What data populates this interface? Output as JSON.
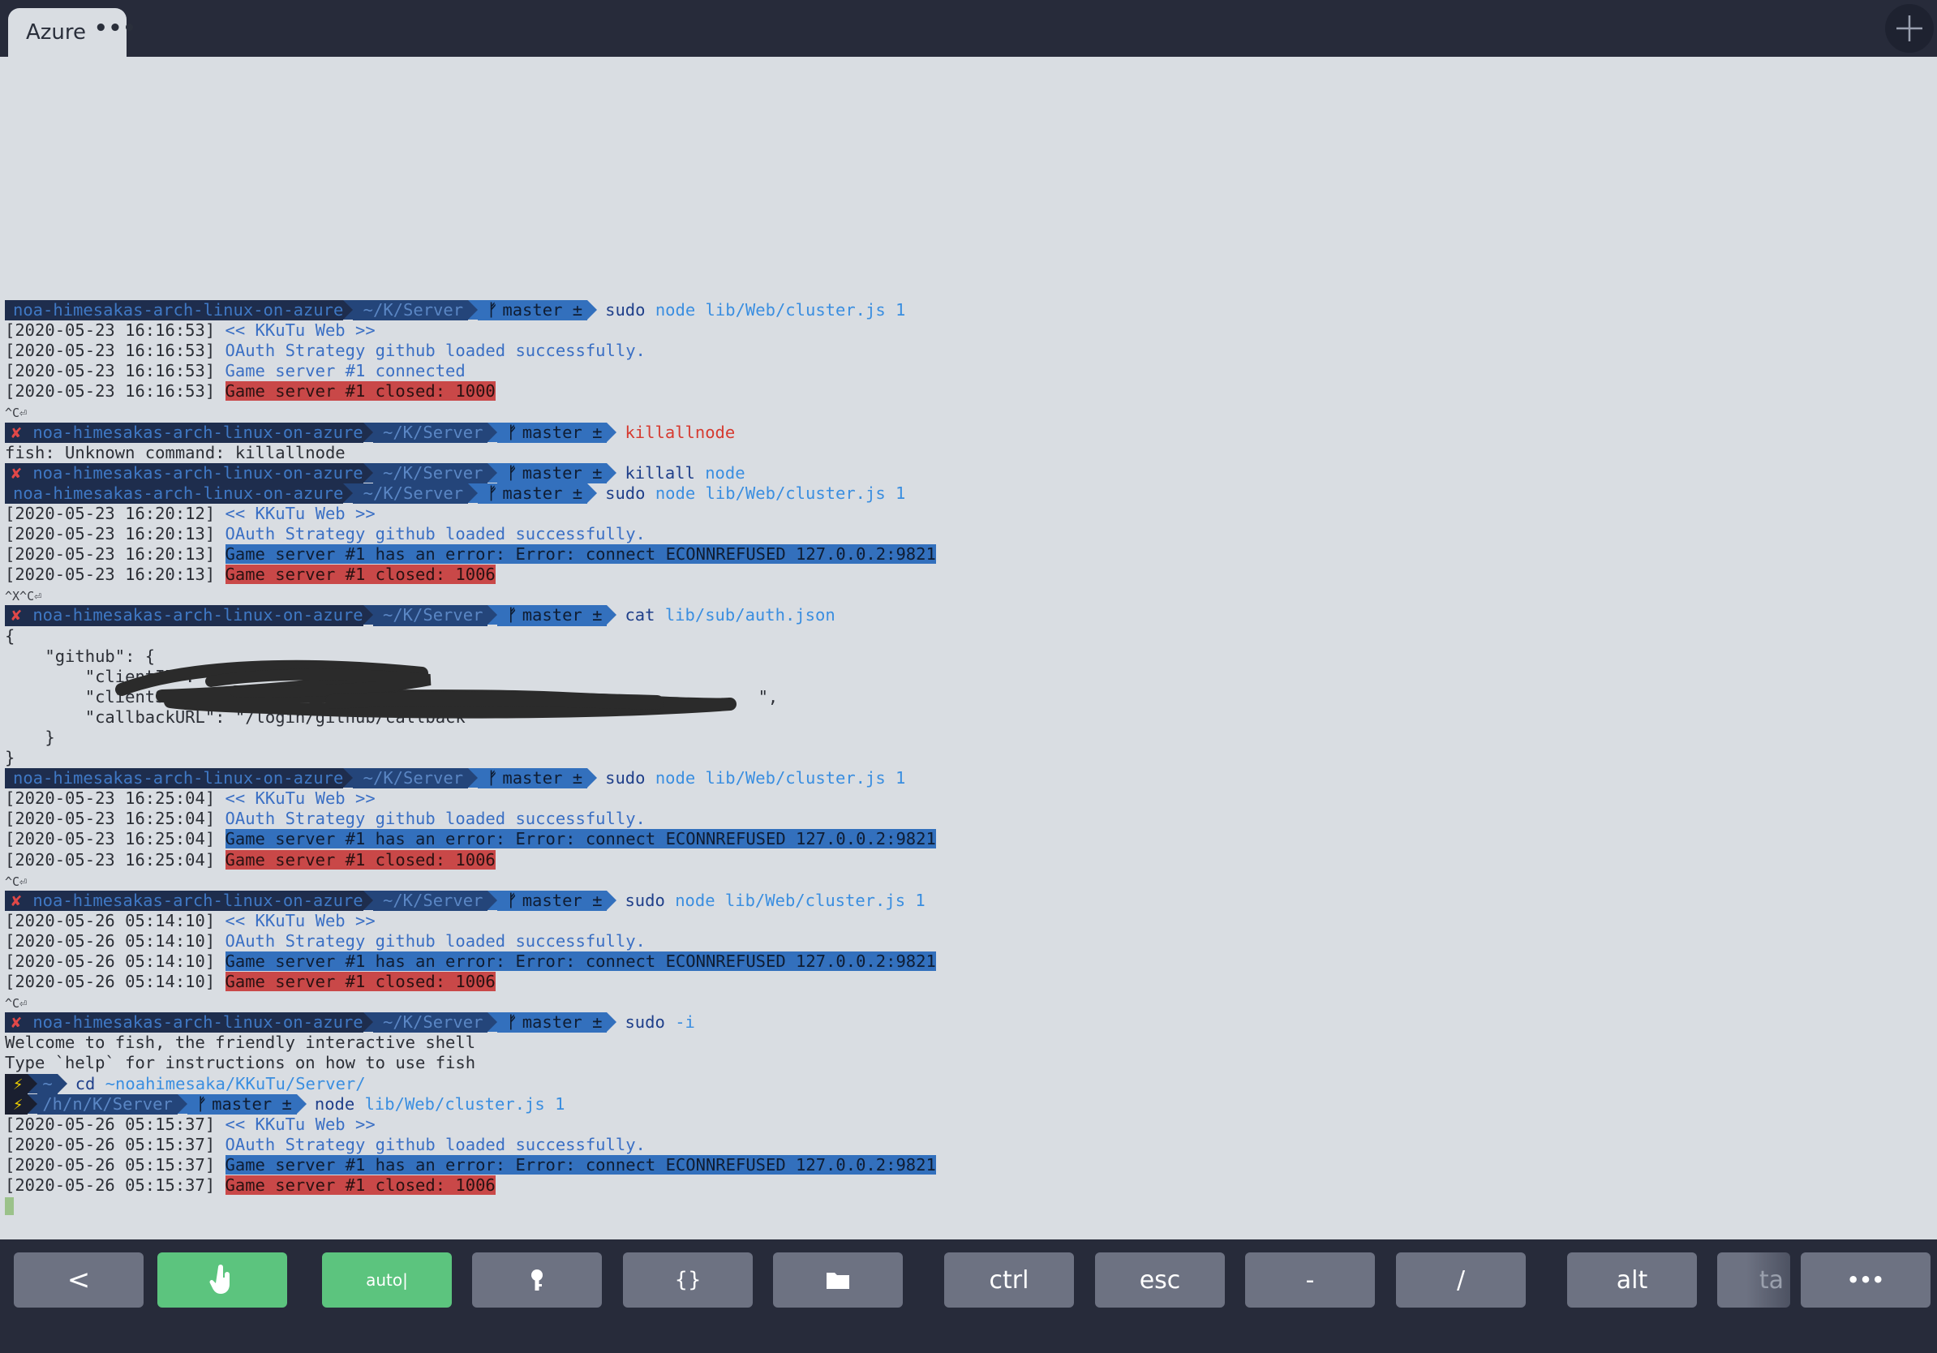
{
  "tab": {
    "title": "Azure",
    "more": "•••"
  },
  "prompt": {
    "host": "noa-himesakas-arch-linux-on-azure",
    "dir": "~/K/Server",
    "branch": "master ±",
    "error_mark": "✘",
    "root_symbol": "⚡",
    "root_home": "~",
    "root_dir": "/h/n/K/Server"
  },
  "lines": {
    "l1_cmd": "sudo",
    "l1_arg": "node lib/Web/cluster.js 1",
    "l2_ts": "[2020-05-23 16:16:53]",
    "l2_msg": "<< KKuTu Web >>",
    "l3_ts": "[2020-05-23 16:16:53]",
    "l3_msg": "OAuth Strategy github loaded successfully.",
    "l4_ts": "[2020-05-23 16:16:53]",
    "l4_msg": "Game server #1 connected",
    "l5_ts": "[2020-05-23 16:16:53]",
    "l5_msg": "Game server #1 closed: 1000",
    "l6": "^C⏎",
    "l7_cmd": "killallnode",
    "l8": "fish: Unknown command: killallnode",
    "l9_cmd": "killall",
    "l9_arg": "node",
    "l10_cmd": "sudo",
    "l10_arg": "node lib/Web/cluster.js 1",
    "l11_ts": "[2020-05-23 16:20:12]",
    "l11_msg": "<< KKuTu Web >>",
    "l12_ts": "[2020-05-23 16:20:13]",
    "l12_msg": "OAuth Strategy github loaded successfully.",
    "l13_ts": "[2020-05-23 16:20:13]",
    "l13_msg": "Game server #1 has an error: Error: connect ECONNREFUSED 127.0.0.2:9821",
    "l14_ts": "[2020-05-23 16:20:13]",
    "l14_msg": "Game server #1 closed: 1006",
    "l15": "^X^C⏎",
    "l16_cmd": "cat",
    "l16_arg": "lib/sub/auth.json",
    "l17": "{",
    "l18": "    \"github\": {",
    "l19": "        \"clientID\": \"",
    "l20": "        \"clientSecret\": \"",
    "l20_end": "\",",
    "l21": "        \"callbackURL\": \"/login/github/callback\"",
    "l22": "    }",
    "l23": "}",
    "l24_cmd": "sudo",
    "l24_arg": "node lib/Web/cluster.js 1",
    "l25_ts": "[2020-05-23 16:25:04]",
    "l25_msg": "<< KKuTu Web >>",
    "l26_ts": "[2020-05-23 16:25:04]",
    "l26_msg": "OAuth Strategy github loaded successfully.",
    "l27_ts": "[2020-05-23 16:25:04]",
    "l27_msg": "Game server #1 has an error: Error: connect ECONNREFUSED 127.0.0.2:9821",
    "l28_ts": "[2020-05-23 16:25:04]",
    "l28_msg": "Game server #1 closed: 1006",
    "l29": "^C⏎",
    "l30_cmd": "sudo",
    "l30_arg": "node lib/Web/cluster.js 1",
    "l31_ts": "[2020-05-26 05:14:10]",
    "l31_msg": "<< KKuTu Web >>",
    "l32_ts": "[2020-05-26 05:14:10]",
    "l32_msg": "OAuth Strategy github loaded successfully.",
    "l33_ts": "[2020-05-26 05:14:10]",
    "l33_msg": "Game server #1 has an error: Error: connect ECONNREFUSED 127.0.0.2:9821",
    "l34_ts": "[2020-05-26 05:14:10]",
    "l34_msg": "Game server #1 closed: 1006",
    "l35": "^C⏎",
    "l36_cmd": "sudo",
    "l36_arg": "-i",
    "l37": "Welcome to fish, the friendly interactive shell",
    "l38": "Type `help` for instructions on how to use fish",
    "l39_cmd": "cd",
    "l39_arg": "~noahimesaka/KKuTu/Server/",
    "l40_cmd": "node",
    "l40_arg": "lib/Web/cluster.js 1",
    "l41_ts": "[2020-05-26 05:15:37]",
    "l41_msg": "<< KKuTu Web >>",
    "l42_ts": "[2020-05-26 05:15:37]",
    "l42_msg": "OAuth Strategy github loaded successfully.",
    "l43_ts": "[2020-05-26 05:15:37]",
    "l43_msg": "Game server #1 has an error: Error: connect ECONNREFUSED 127.0.0.2:9821",
    "l44_ts": "[2020-05-26 05:15:37]",
    "l44_msg": "Game server #1 closed: 1006"
  },
  "keybar": {
    "back": "<",
    "touch_icon": "touch-icon",
    "auto": "auto|",
    "key_icon": "key-icon",
    "braces": "{}",
    "folder_icon": "folder-icon",
    "ctrl": "ctrl",
    "esc": "esc",
    "dash": "-",
    "slash": "/",
    "alt": "alt",
    "tab": "ta",
    "more": "•••"
  },
  "colors": {
    "bar_bg": "#272b3a",
    "terminal_bg": "#d9dde2",
    "key_bg": "#6d7282",
    "key_green": "#5cc47e",
    "error_red": "#c94848",
    "highlight_blue": "#3370bd"
  }
}
